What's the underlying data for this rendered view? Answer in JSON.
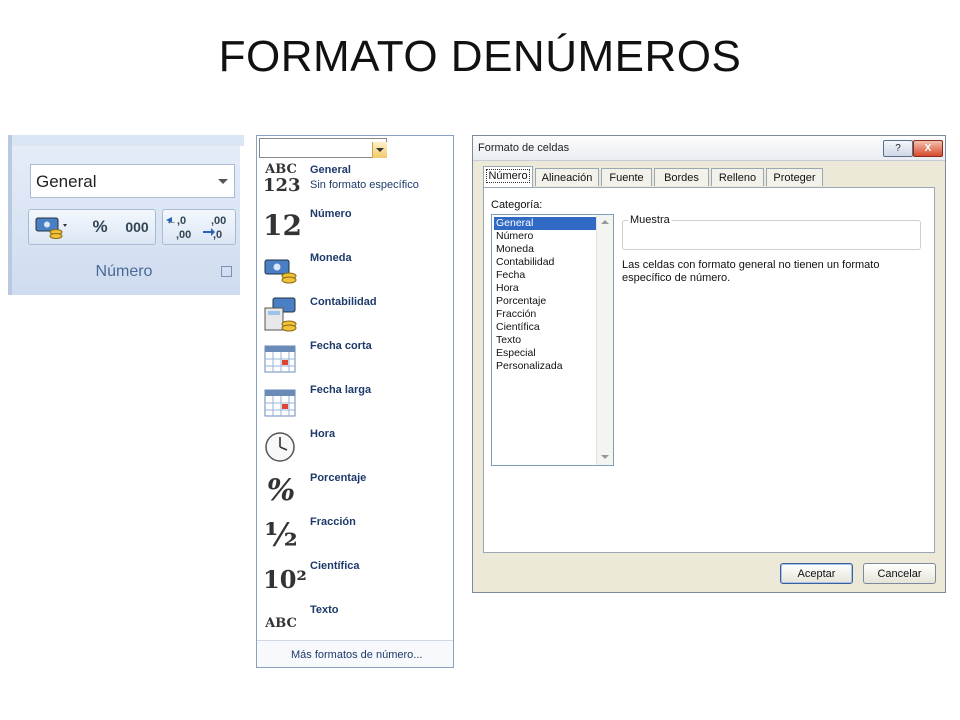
{
  "slide": {
    "title": "FORMATO DENÚMEROS"
  },
  "ribbon": {
    "format_value": "General",
    "percent_label": "%",
    "thousands_label": "000",
    "increase_decimals_label": "←,0 ,00",
    "decrease_decimals_label": ",00 →,0",
    "group_label": "Número"
  },
  "dropdown": {
    "items": [
      {
        "label": "General",
        "sub": "Sin formato específico",
        "icon_text": "ABC 123",
        "icon": "abc123-icon"
      },
      {
        "label": "Número",
        "icon_text": "12",
        "icon": "number-icon"
      },
      {
        "label": "Moneda",
        "icon": "currency-icon"
      },
      {
        "label": "Contabilidad",
        "icon": "accounting-icon"
      },
      {
        "label": "Fecha corta",
        "icon": "calendar-icon"
      },
      {
        "label": "Fecha larga",
        "icon": "calendar-icon"
      },
      {
        "label": "Hora",
        "icon": "clock-icon"
      },
      {
        "label": "Porcentaje",
        "icon_text": "%",
        "icon": "percent-icon"
      },
      {
        "label": "Fracción",
        "icon_text": "½",
        "icon": "fraction-icon"
      },
      {
        "label": "Científica",
        "icon_text": "10²",
        "icon": "scientific-icon"
      },
      {
        "label": "Texto",
        "icon_text": "ABC",
        "icon": "text-icon"
      }
    ],
    "footer": "Más formatos de número..."
  },
  "dialog": {
    "title": "Formato de celdas",
    "help_label": "?",
    "close_label": "X",
    "tabs": [
      "Número",
      "Alineación",
      "Fuente",
      "Bordes",
      "Relleno",
      "Proteger"
    ],
    "category_label": "Categoría:",
    "categories": [
      "General",
      "Número",
      "Moneda",
      "Contabilidad",
      "Fecha",
      "Hora",
      "Porcentaje",
      "Fracción",
      "Científica",
      "Texto",
      "Especial",
      "Personalizada"
    ],
    "selected_category": "General",
    "sample_label": "Muestra",
    "description": "Las celdas con formato general no tienen un formato específico de número.",
    "ok_label": "Aceptar",
    "cancel_label": "Cancelar"
  },
  "colors": {
    "selection": "#316ac5",
    "ribbon": "#dbe6f4",
    "dialog_bg": "#ece9d8"
  }
}
